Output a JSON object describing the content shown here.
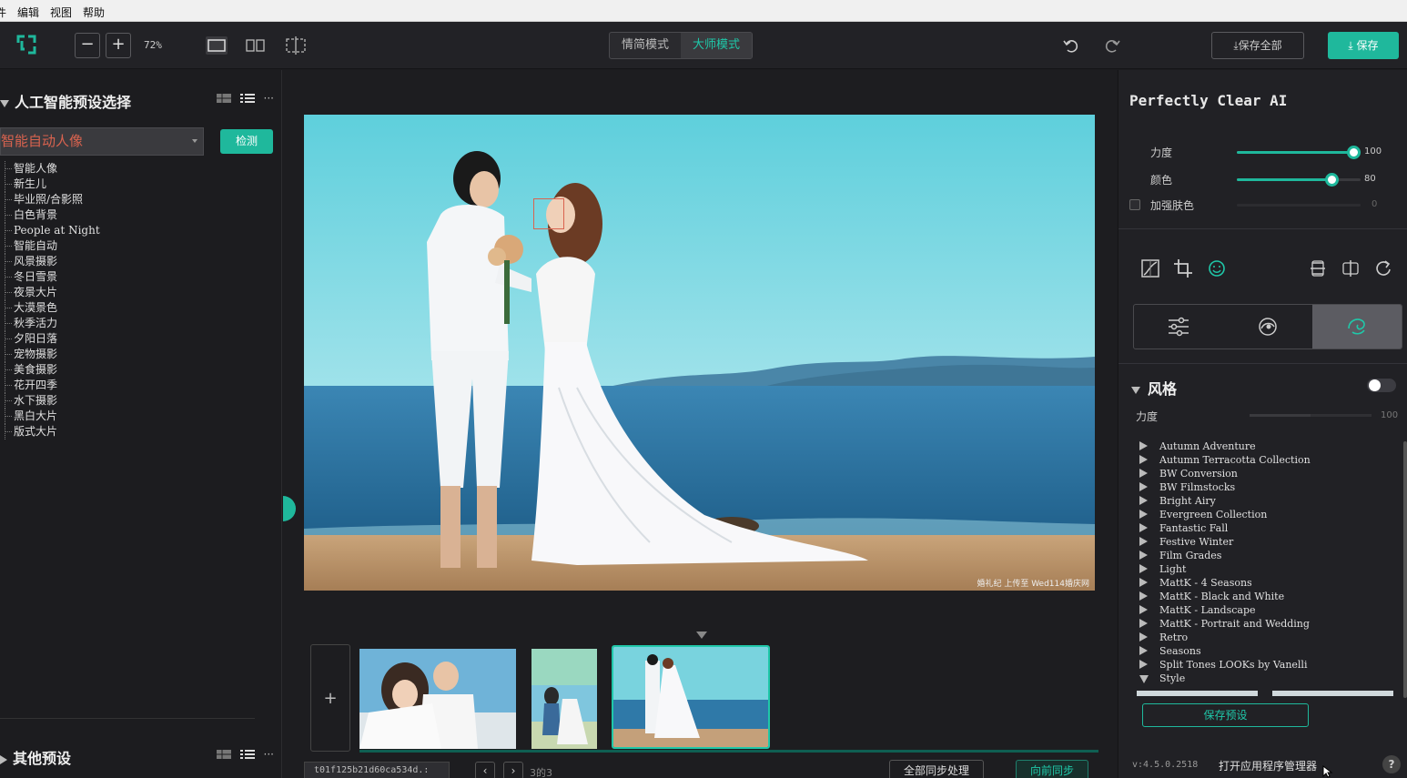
{
  "menubar": [
    "件",
    "编辑",
    "视图",
    "帮助"
  ],
  "toolbar": {
    "zoom": "72%",
    "modes": [
      "情简模式",
      "大师模式"
    ],
    "save_all": "保存全部",
    "save": "保存"
  },
  "left": {
    "title": "人工智能预设选择",
    "select_value": "智能自动人像",
    "detect": "检测",
    "presets": [
      "智能人像",
      "新生儿",
      "毕业照/合影照",
      "白色背景",
      "People at Night",
      "智能自动",
      "风景摄影",
      "冬日雪景",
      "夜景大片",
      "大漠景色",
      "秋季活力",
      "夕阳日落",
      "宠物摄影",
      "美食摄影",
      "花开四季",
      "水下摄影",
      "黑白大片",
      "版式大片"
    ],
    "other_title": "其他预设"
  },
  "canvas": {
    "watermark": "婚礼纪 上传至 Wed114婚庆网",
    "file_name": "t01f125b21d60ca534d.:",
    "page_count": "3的3",
    "sync_all": "全部同步处理",
    "sync_forward": "向前同步",
    "add_symbol": "+"
  },
  "right": {
    "title": "Perfectly Clear AI",
    "sliders": [
      {
        "label": "力度",
        "value": "100",
        "fraction": 1.0
      },
      {
        "label": "颜色",
        "value": "80",
        "fraction": 0.8
      }
    ],
    "enhance_skin": {
      "label": "加强肤色",
      "value": "0"
    },
    "style_section": "风格",
    "style_strength_label": "力度",
    "style_strength_value": "100",
    "styles": [
      "Autumn Adventure",
      "Autumn Terracotta Collection",
      "BW Conversion",
      "BW Filmstocks",
      "Bright Airy",
      "Evergreen Collection",
      "Fantastic Fall",
      "Festive Winter",
      "Film Grades",
      "Light",
      "MattK - 4 Seasons",
      "MattK - Black and White",
      "MattK - Landscape",
      "MattK - Portrait and Wedding",
      "Retro",
      "Seasons",
      "Split Tones LOOKs by Vanelli",
      "Style"
    ],
    "save_preset": "保存预设",
    "version": "v:4.5.0.2518",
    "app_manager": "打开应用程序管理器",
    "help": "?"
  },
  "colors": {
    "accent": "#1fb89c",
    "accent_text": "#1fc8a9",
    "highlight_red": "#d9634f"
  }
}
